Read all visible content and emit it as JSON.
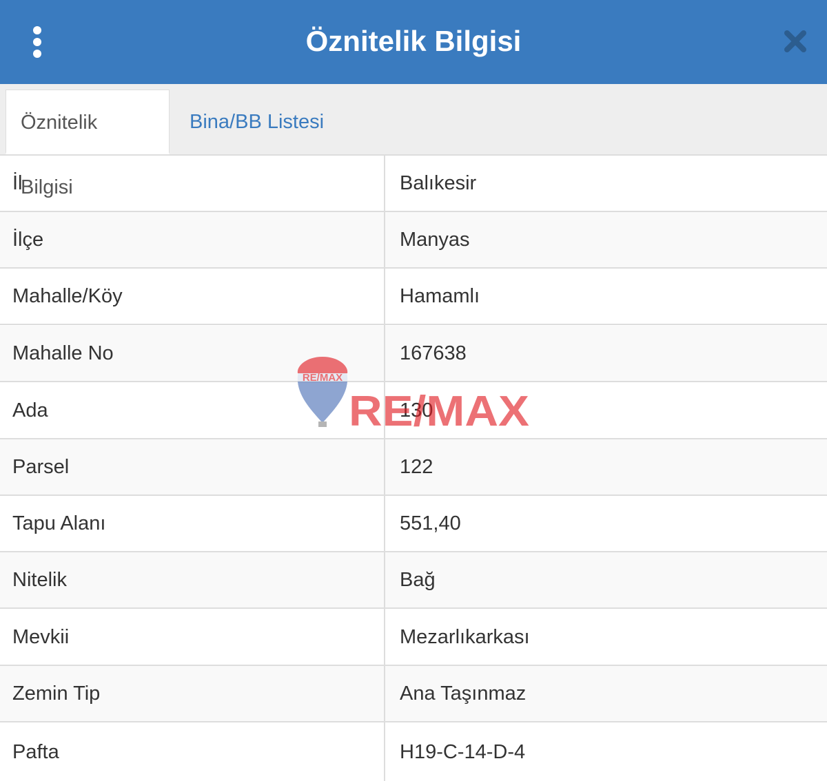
{
  "header": {
    "title": "Öznitelik Bilgisi",
    "menu_icon": "kebab-menu-icon",
    "close_icon": "close-icon"
  },
  "tabs": [
    {
      "label": "Öznitelik Bilgisi",
      "active": true
    },
    {
      "label": "Bina/BB Listesi",
      "active": false
    }
  ],
  "attributes": [
    {
      "key": "İl",
      "value": "Balıkesir"
    },
    {
      "key": "İlçe",
      "value": "Manyas"
    },
    {
      "key": "Mahalle/Köy",
      "value": "Hamamlı"
    },
    {
      "key": "Mahalle No",
      "value": "167638"
    },
    {
      "key": "Ada",
      "value": "130"
    },
    {
      "key": "Parsel",
      "value": "122"
    },
    {
      "key": "Tapu Alanı",
      "value": "551,40"
    },
    {
      "key": "Nitelik",
      "value": "Bağ"
    },
    {
      "key": "Mevkii",
      "value": "Mezarlıkarkası"
    },
    {
      "key": "Zemin Tip",
      "value": "Ana Taşınmaz"
    },
    {
      "key": "Pafta",
      "value": "H19-C-14-D-4"
    }
  ],
  "watermark": {
    "balloon_text": "RE/MAX",
    "text": "RE/MAX",
    "colors": {
      "red": "#e11b22",
      "blue": "#003da5"
    }
  },
  "colors": {
    "header_bg": "#3a7bbf",
    "tab_link": "#3a7bbf",
    "border": "#dddddd"
  }
}
